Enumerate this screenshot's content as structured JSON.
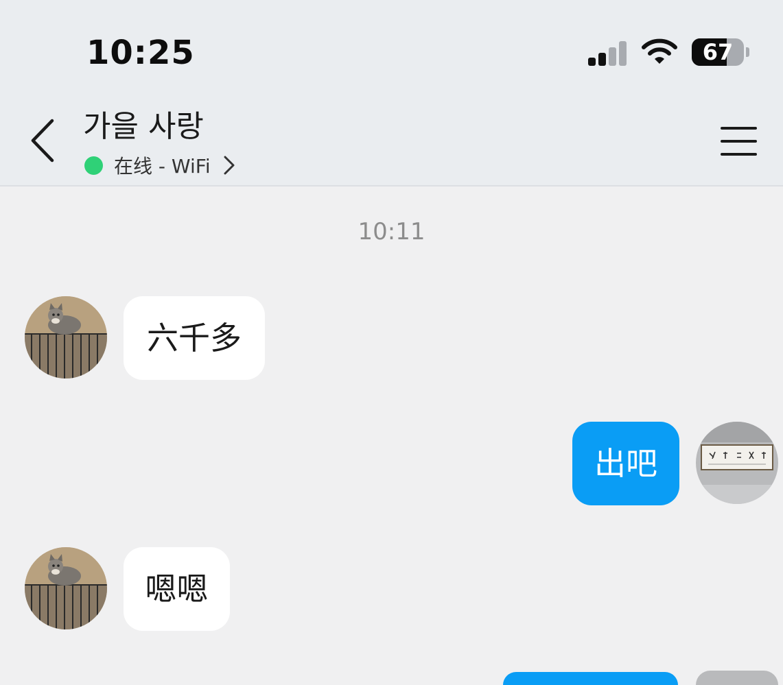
{
  "status_bar": {
    "time": "10:25",
    "battery": "67"
  },
  "header": {
    "title": "가을 사랑",
    "status": "在线 - WiFi"
  },
  "chat": {
    "timestamp": "10:11",
    "messages": [
      {
        "side": "received",
        "text": "六千多"
      },
      {
        "side": "sent",
        "text": "出吧"
      },
      {
        "side": "received",
        "text": "嗯嗯"
      }
    ]
  },
  "colors": {
    "header_bg": "#eaedf0",
    "chat_bg": "#f0f0f1",
    "sent_bubble": "#0a9df5",
    "received_bubble": "#ffffff",
    "online_dot": "#2fd177"
  },
  "icons": [
    "signal-icon",
    "wifi-icon",
    "battery-icon",
    "back-arrow-icon",
    "chevron-right-icon",
    "menu-icon"
  ]
}
